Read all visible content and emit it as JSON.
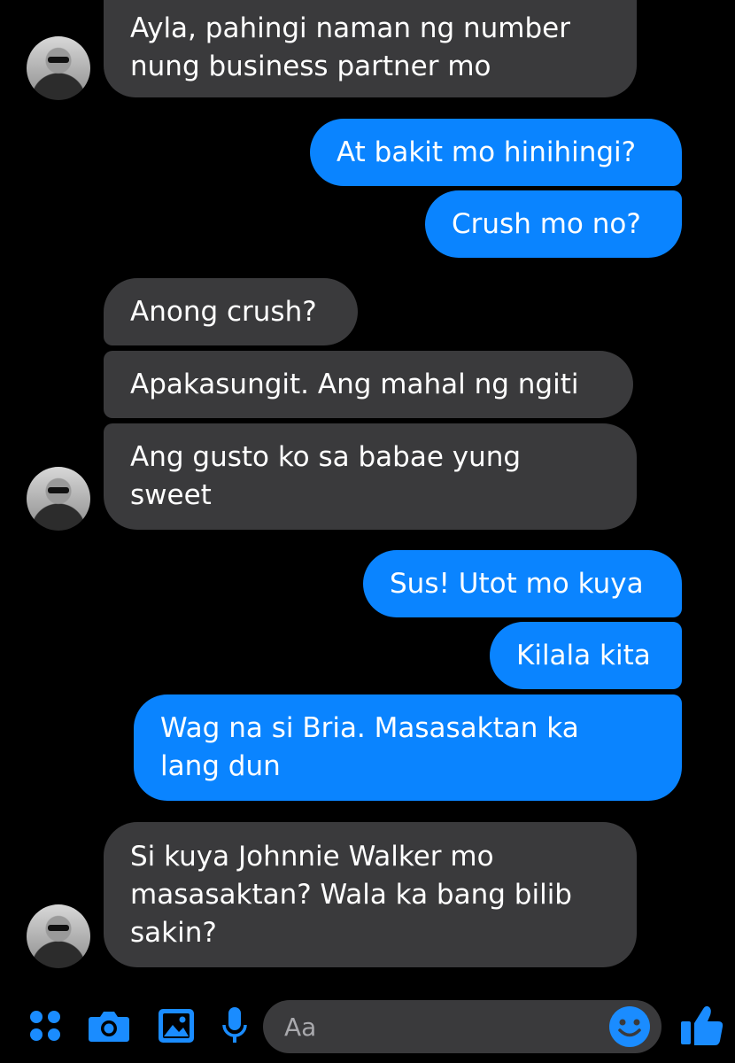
{
  "messages": [
    {
      "side": "in",
      "lines": [
        "Ayla, pahingi naman ng number",
        "nung business partner mo"
      ]
    },
    {
      "side": "out",
      "lines": [
        "At bakit mo hinihingi?"
      ]
    },
    {
      "side": "out",
      "lines": [
        "Crush mo no?"
      ]
    },
    {
      "side": "in",
      "lines": [
        "Anong crush?"
      ]
    },
    {
      "side": "in",
      "lines": [
        "Apakasungit. Ang mahal ng ngiti"
      ]
    },
    {
      "side": "in",
      "lines": [
        "Ang gusto ko sa babae yung",
        "sweet"
      ]
    },
    {
      "side": "out",
      "lines": [
        "Sus! Utot mo kuya"
      ]
    },
    {
      "side": "out",
      "lines": [
        "Kilala kita"
      ]
    },
    {
      "side": "out",
      "lines": [
        "Wag na si Bria. Masasaktan ka",
        "lang dun"
      ]
    },
    {
      "side": "in",
      "lines": [
        "Si kuya Johnnie Walker mo",
        "masasaktan? Wala ka bang bilib",
        "sakin?"
      ]
    }
  ],
  "composer": {
    "placeholder": "Aa",
    "icons": [
      "apps-icon",
      "camera-icon",
      "gallery-icon",
      "microphone-icon",
      "emoji-icon",
      "thumbs-up-icon"
    ]
  },
  "colors": {
    "outgoing": "#0a84ff",
    "incoming": "#3a3a3c",
    "accent": "#1a8cff"
  }
}
